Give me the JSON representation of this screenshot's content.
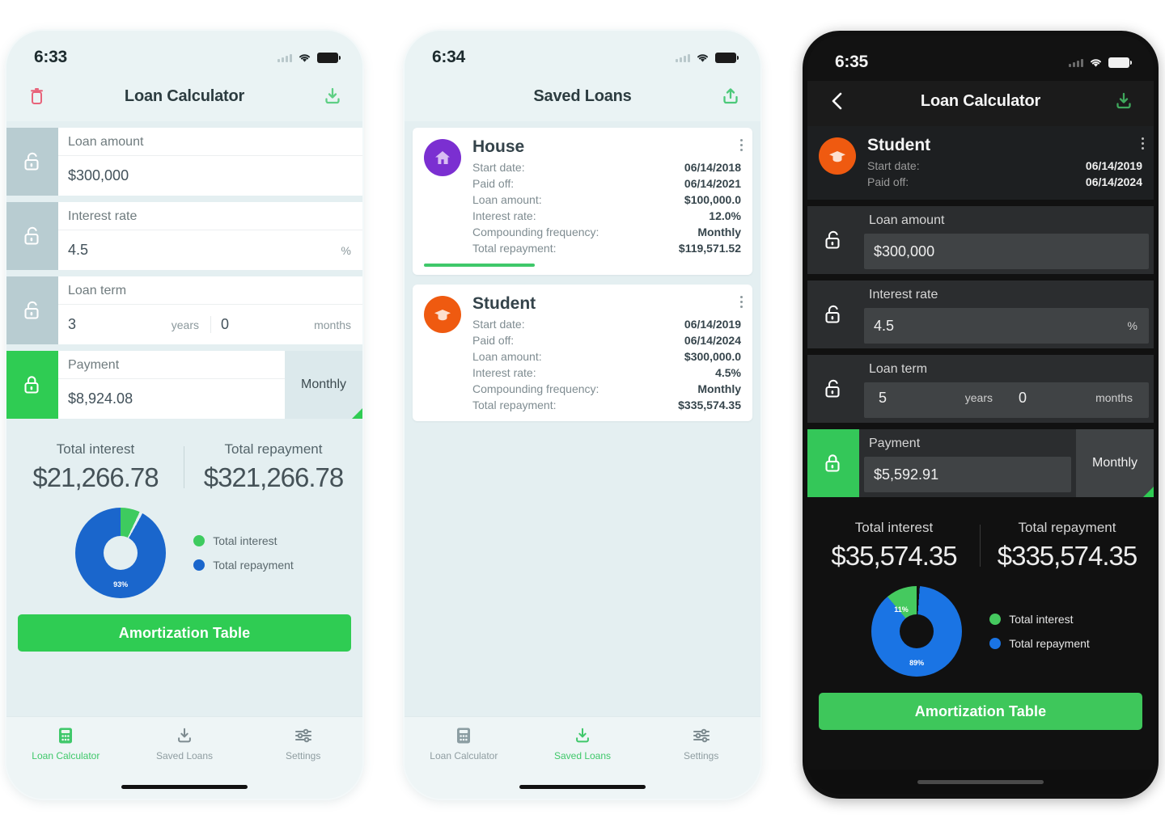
{
  "colors": {
    "green": "#2fcc53",
    "blue": "#1a66cc",
    "light_green": "#45c95f",
    "purple": "#7b2fd1",
    "orange": "#ef5a10",
    "light_bg": "#e4eff1",
    "dark_bg": "#111111",
    "danger": "#e8637a"
  },
  "phone1": {
    "status": {
      "time": "6:33"
    },
    "appbar": {
      "title": "Loan Calculator",
      "left_icon": "trash-icon",
      "right_icon": "download-icon"
    },
    "fields": [
      {
        "label": "Loan amount",
        "value": "$300,000",
        "unit": "",
        "locked": false
      },
      {
        "label": "Interest rate",
        "value": "4.5",
        "unit": "%",
        "locked": false
      },
      {
        "label": "Loan term",
        "value": "3",
        "unit": "years",
        "value2": "0",
        "unit2": "months",
        "locked": false
      },
      {
        "label": "Payment",
        "value": "$8,924.08",
        "frequency": "Monthly",
        "locked": true
      }
    ],
    "summary": {
      "interest_label": "Total interest",
      "interest_value": "$21,266.78",
      "repayment_label": "Total repayment",
      "repayment_value": "$321,266.78"
    },
    "chart_data": {
      "type": "pie",
      "title": "",
      "labels": [
        "Total interest",
        "Total repayment"
      ],
      "values": [
        7,
        93
      ],
      "value_labels": [
        "7%",
        "93%"
      ],
      "colors": [
        "#3ecb5f",
        "#1a66cc"
      ],
      "legend_position": "right",
      "donut": true
    },
    "cta": "Amortization Table",
    "tabs": [
      {
        "label": "Loan Calculator",
        "icon": "calculator-icon",
        "active": true
      },
      {
        "label": "Saved Loans",
        "icon": "download-icon",
        "active": false
      },
      {
        "label": "Settings",
        "icon": "sliders-icon",
        "active": false
      }
    ]
  },
  "phone2": {
    "status": {
      "time": "6:34"
    },
    "appbar": {
      "title": "Saved Loans",
      "right_icon": "share-icon"
    },
    "row_labels": {
      "start_date": "Start date:",
      "paid_off": "Paid off:",
      "loan_amount": "Loan amount:",
      "interest_rate": "Interest rate:",
      "compounding": "Compounding frequency:",
      "total_repayment": "Total repayment:"
    },
    "loans": [
      {
        "name": "House",
        "icon": "house-icon",
        "avatar_color": "#7b2fd1",
        "start_date": "06/14/2018",
        "paid_off": "06/14/2021",
        "loan_amount": "$100,000.0",
        "interest_rate": "12.0%",
        "compounding": "Monthly",
        "total_repayment": "$119,571.52",
        "progress": 35
      },
      {
        "name": "Student",
        "icon": "graduation-cap-icon",
        "avatar_color": "#ef5a10",
        "start_date": "06/14/2019",
        "paid_off": "06/14/2024",
        "loan_amount": "$300,000.0",
        "interest_rate": "4.5%",
        "compounding": "Monthly",
        "total_repayment": "$335,574.35",
        "progress": 0
      }
    ],
    "tabs": [
      {
        "label": "Loan Calculator",
        "icon": "calculator-icon",
        "active": false
      },
      {
        "label": "Saved Loans",
        "icon": "download-icon",
        "active": true
      },
      {
        "label": "Settings",
        "icon": "sliders-icon",
        "active": false
      }
    ]
  },
  "phone3": {
    "status": {
      "time": "6:35"
    },
    "appbar": {
      "title": "Loan Calculator",
      "left_icon": "back-chevron-icon",
      "right_icon": "download-icon"
    },
    "loan_header": {
      "name": "Student",
      "icon": "graduation-cap-icon",
      "avatar_color": "#ef5a10",
      "start_date_label": "Start date:",
      "start_date": "06/14/2019",
      "paid_off_label": "Paid off:",
      "paid_off": "06/14/2024"
    },
    "fields": [
      {
        "label": "Loan amount",
        "value": "$300,000",
        "unit": "",
        "locked": false
      },
      {
        "label": "Interest rate",
        "value": "4.5",
        "unit": "%",
        "locked": false
      },
      {
        "label": "Loan term",
        "value": "5",
        "unit": "years",
        "value2": "0",
        "unit2": "months",
        "locked": false
      },
      {
        "label": "Payment",
        "value": "$5,592.91",
        "frequency": "Monthly",
        "locked": true
      }
    ],
    "summary": {
      "interest_label": "Total interest",
      "interest_value": "$35,574.35",
      "repayment_label": "Total repayment",
      "repayment_value": "$335,574.35"
    },
    "chart_data": {
      "type": "pie",
      "title": "",
      "labels": [
        "Total interest",
        "Total repayment"
      ],
      "values": [
        11,
        89
      ],
      "value_labels": [
        "11%",
        "89%"
      ],
      "colors": [
        "#45c95f",
        "#1a74e4"
      ],
      "legend_position": "right",
      "donut": true
    },
    "cta": "Amortization Table"
  }
}
